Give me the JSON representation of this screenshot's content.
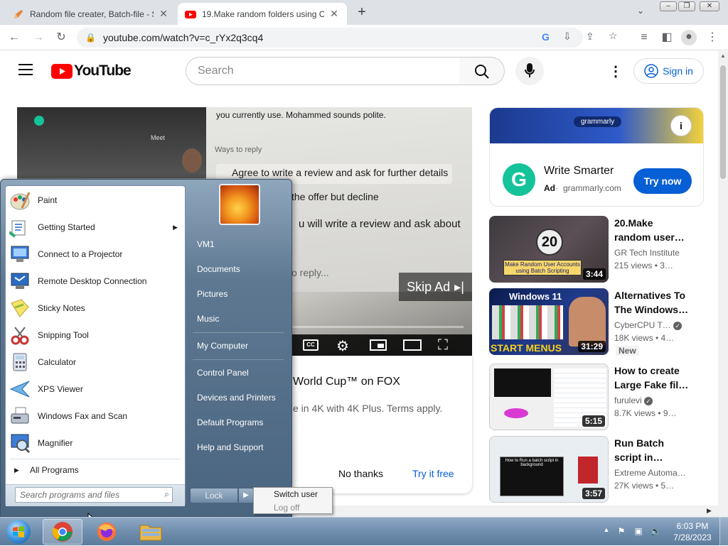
{
  "browser": {
    "tabs": [
      {
        "title": "Random file creater, Batch-file - S"
      },
      {
        "title": "19.Make random folders using C"
      }
    ],
    "new_tab_label": "+",
    "url": "youtube.com/watch?v=c_rYx2q3cq4"
  },
  "youtube": {
    "logo_text": "YouTube",
    "search_placeholder": "Search",
    "signin_label": "Sign in",
    "player": {
      "chat_lines": [
        "you currently use. Mohammed sounds polite.",
        "Ways to reply",
        "Agree to write a review and ask for further details",
        "the offer but decline",
        "u will write a review and ask about",
        "o reply..."
      ],
      "meet_label": "Meet",
      "skip_ad_label": "Skip Ad"
    },
    "ad_card": {
      "title": "World Cup™ on FOX",
      "body": "e in 4K with 4K Plus. Terms apply.",
      "no_thanks": "No thanks",
      "try_free": "Try it free"
    },
    "side_ad": {
      "brand_banner": "grammarly",
      "title": "Write Smarter",
      "ad_badge": "Ad",
      "domain": "grammarly.com",
      "cta": "Try now"
    },
    "related": [
      {
        "title_l1": "20.Make",
        "title_l2": "random user…",
        "channel": "GR Tech Institute",
        "meta": "215 views • 3…",
        "duration": "3:44",
        "thumb_number": "20",
        "thumb_caption": "Make Random User Accounts using Batch Scripting"
      },
      {
        "title_l1": "Alternatives To",
        "title_l2": "The Windows…",
        "channel": "CyberCPU T…",
        "meta": "18K views • 4…",
        "badge": "New",
        "duration": "31:29",
        "thumb_top": "Windows 11",
        "thumb_bottom": "START MENUS"
      },
      {
        "title_l1": "How to create",
        "title_l2": "Large Fake fil…",
        "channel": "furulevi",
        "meta": "8.7K views • 9…",
        "duration": "5:15"
      },
      {
        "title_l1": "Run Batch",
        "title_l2": "script in…",
        "channel": "Extreme Automa…",
        "meta": "27K views • 5…",
        "duration": "3:57",
        "thumb_caption": "How to Run a batch script in background"
      }
    ]
  },
  "start_menu": {
    "programs": [
      {
        "label": "Paint",
        "icon": "paint-icon"
      },
      {
        "label": "Getting Started",
        "icon": "getting-started-icon",
        "submenu": true
      },
      {
        "label": "Connect to a Projector",
        "icon": "projector-icon"
      },
      {
        "label": "Remote Desktop Connection",
        "icon": "remote-desktop-icon"
      },
      {
        "label": "Sticky Notes",
        "icon": "sticky-notes-icon"
      },
      {
        "label": "Snipping Tool",
        "icon": "snipping-tool-icon"
      },
      {
        "label": "Calculator",
        "icon": "calculator-icon"
      },
      {
        "label": "XPS Viewer",
        "icon": "xps-viewer-icon"
      },
      {
        "label": "Windows Fax and Scan",
        "icon": "fax-scan-icon"
      },
      {
        "label": "Magnifier",
        "icon": "magnifier-icon"
      }
    ],
    "all_programs": "All Programs",
    "search_placeholder": "Search programs and files",
    "right_items": [
      "VM1",
      "Documents",
      "Pictures",
      "Music",
      "My Computer",
      "Control Panel",
      "Devices and Printers",
      "Default Programs",
      "Help and Support"
    ],
    "lock_label": "Lock",
    "flyout": {
      "switch_user": "Switch user",
      "log_off": "Log off"
    }
  },
  "taskbar": {
    "time": "6:03 PM",
    "date": "7/28/2023"
  }
}
